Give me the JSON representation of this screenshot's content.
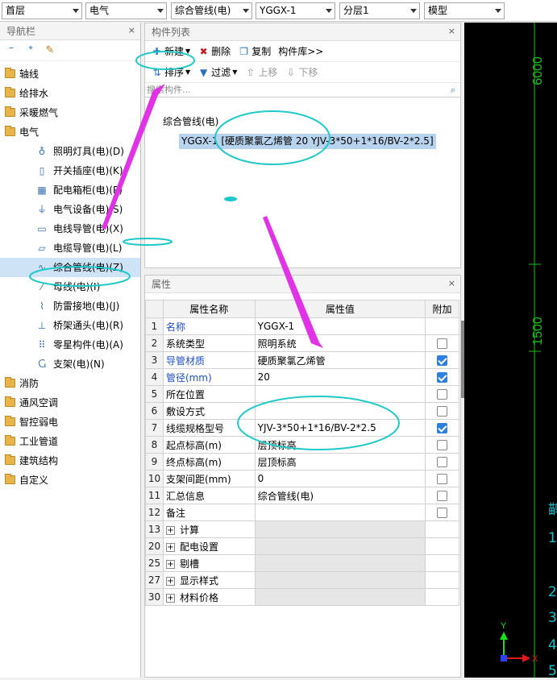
{
  "topbar": {
    "floor": "首层",
    "discipline": "电气",
    "type": "综合管线(电)",
    "component": "YGGX-1",
    "layer": "分层1",
    "mode": "模型"
  },
  "nav": {
    "title": "导航栏",
    "close": "×",
    "items": [
      {
        "label": "轴线"
      },
      {
        "label": "给排水"
      },
      {
        "label": "采暖燃气"
      },
      {
        "label": "电气"
      },
      {
        "label": "照明灯具(电)(D)"
      },
      {
        "label": "开关插座(电)(K)"
      },
      {
        "label": "配电箱柜(电)(P)"
      },
      {
        "label": "电气设备(电)(S)"
      },
      {
        "label": "电线导管(电)(X)"
      },
      {
        "label": "电缆导管(电)(L)"
      },
      {
        "label": "综合管线(电)(Z)"
      },
      {
        "label": "母线(电)(I)"
      },
      {
        "label": "防雷接地(电)(J)"
      },
      {
        "label": "桥架通头(电)(R)"
      },
      {
        "label": "零星构件(电)(A)"
      },
      {
        "label": "支架(电)(N)"
      },
      {
        "label": "消防"
      },
      {
        "label": "通风空调"
      },
      {
        "label": "智控弱电"
      },
      {
        "label": "工业管道"
      },
      {
        "label": "建筑结构"
      },
      {
        "label": "自定义"
      }
    ]
  },
  "components": {
    "title": "构件列表",
    "close": "×",
    "new": "新建",
    "delete": "删除",
    "copy": "复制",
    "library": "构件库>>",
    "sort": "排序",
    "filter": "过滤",
    "up": "上移",
    "down": "下移",
    "search_placeholder": "搜索构件...",
    "group": "综合管线(电)",
    "item": "YGGX-1 [硬质聚氯乙烯管 20 YJV-3*50+1*16/BV-2*2.5]"
  },
  "properties": {
    "title": "属性",
    "close": "×",
    "headers": {
      "name": "属性名称",
      "value": "属性值",
      "extra": "附加"
    },
    "rows": [
      {
        "n": "1",
        "name": "名称",
        "value": "YGGX-1"
      },
      {
        "n": "2",
        "name": "系统类型",
        "value": "照明系统"
      },
      {
        "n": "3",
        "name": "导管材质",
        "value": "硬质聚氯乙烯管"
      },
      {
        "n": "4",
        "name": "管径(mm)",
        "value": "20"
      },
      {
        "n": "5",
        "name": "所在位置",
        "value": ""
      },
      {
        "n": "6",
        "name": "敷设方式",
        "value": ""
      },
      {
        "n": "7",
        "name": "线缆规格型号",
        "value": "YJV-3*50+1*16/BV-2*2.5"
      },
      {
        "n": "8",
        "name": "起点标高(m)",
        "value": "层顶标高"
      },
      {
        "n": "9",
        "name": "终点标高(m)",
        "value": "层顶标高"
      },
      {
        "n": "10",
        "name": "支架间距(mm)",
        "value": "0"
      },
      {
        "n": "11",
        "name": "汇总信息",
        "value": "综合管线(电)"
      },
      {
        "n": "12",
        "name": "备注",
        "value": ""
      },
      {
        "n": "13",
        "name": "计算",
        "value": ""
      },
      {
        "n": "20",
        "name": "配电设置",
        "value": ""
      },
      {
        "n": "25",
        "name": "剔槽",
        "value": ""
      },
      {
        "n": "27",
        "name": "显示样式",
        "value": ""
      },
      {
        "n": "30",
        "name": "材料价格",
        "value": ""
      }
    ]
  },
  "cad": {
    "dim_top": "6000",
    "dim_mid": "1500",
    "side_glyphs": [
      "鹋",
      "1.",
      "2",
      "3",
      "4",
      "5"
    ],
    "axis_y": "Y",
    "axis_x": "X"
  },
  "colors": {
    "accent": "#2f7fe0",
    "annotation_ellipse": "#1fc9c9",
    "annotation_arrow": "#e033e6",
    "cad_dim": "#19c019"
  }
}
